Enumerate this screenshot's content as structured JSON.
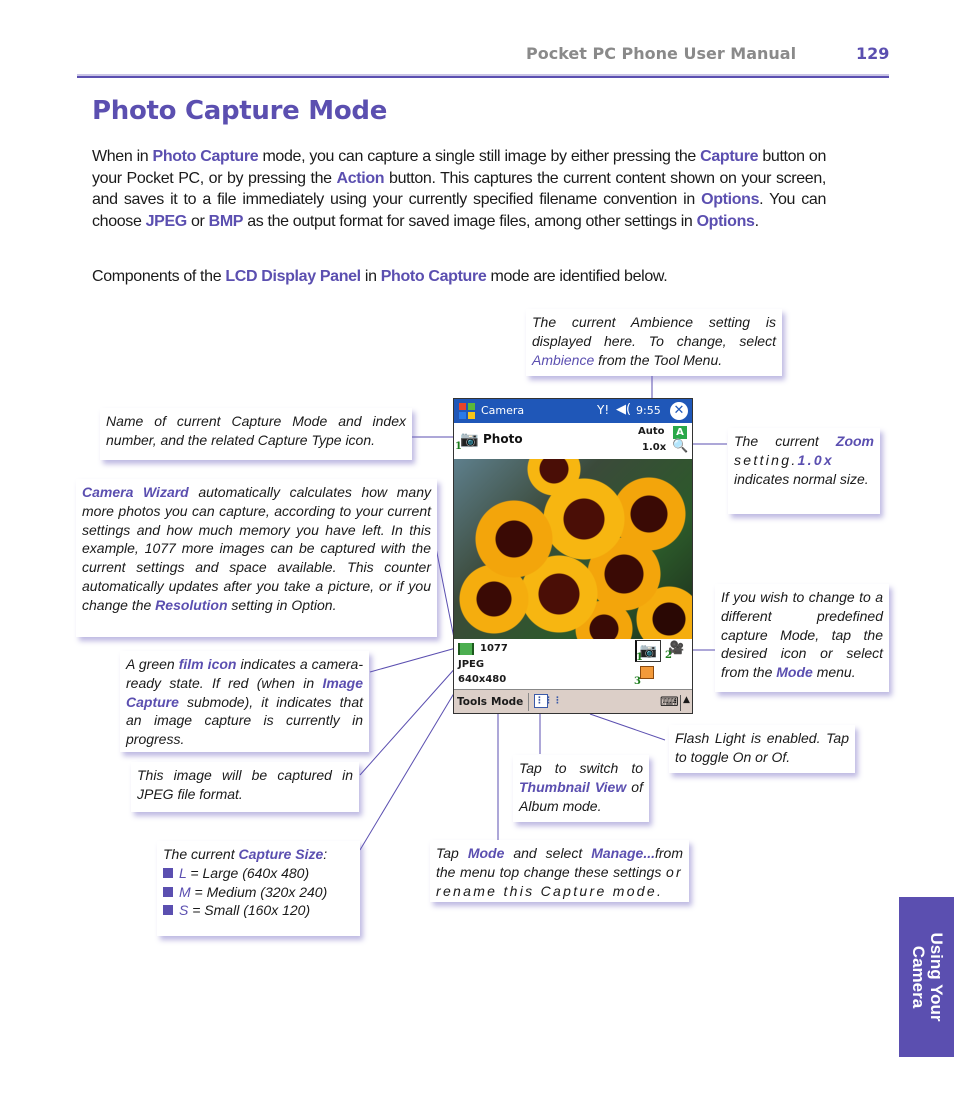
{
  "header": {
    "manual_title": "Pocket PC Phone User Manual",
    "page_number": "129"
  },
  "page_title": "Photo Capture Mode",
  "intro": {
    "p1": [
      {
        "t": "When in "
      },
      {
        "t": "Photo Capture",
        "hl": true
      },
      {
        "t": " mode, you can capture a single still image by either pressing the "
      },
      {
        "t": "Capture",
        "hl": true
      },
      {
        "t": " button on your Pocket PC, or by pressing the "
      },
      {
        "t": "Action",
        "hl": true
      },
      {
        "t": " button.  This captures the current content shown on your screen, and saves it to a file immediately using your currently specified filename convention in "
      },
      {
        "t": "Options",
        "hl": true
      },
      {
        "t": ".  You can choose "
      },
      {
        "t": "JPEG",
        "hl": true
      },
      {
        "t": " or "
      },
      {
        "t": "BMP",
        "hl": true
      },
      {
        "t": " as the output format for saved image files, among other settings in "
      },
      {
        "t": "Options",
        "hl": true
      },
      {
        "t": "."
      }
    ],
    "p2": [
      {
        "t": "Components of the "
      },
      {
        "t": "LCD Display Panel",
        "hl": true
      },
      {
        "t": " in "
      },
      {
        "t": "Photo Capture",
        "hl": true
      },
      {
        "t": " mode are identified below."
      }
    ]
  },
  "callouts": {
    "ambience": [
      {
        "t": "The current Ambience setting is displayed here. To change, select "
      },
      {
        "t": "Ambience",
        "plain_hl": true
      },
      {
        "t": " from the Tool Menu."
      }
    ],
    "mode_name": [
      {
        "t": "Name of current Capture Mode and index number, and the related Capture Type icon."
      }
    ],
    "zoom": [
      {
        "t": "The current "
      },
      {
        "t": "Zoom",
        "hl": true
      },
      {
        "t": " setting.",
        "wide": true
      },
      {
        "t": "1.0x",
        "hl": true,
        "wide": true
      },
      {
        "t": " indicates normal size."
      }
    ],
    "wizard": [
      {
        "t": "Camera  Wizard",
        "hl": true
      },
      {
        "t": " automatically calculates how many more photos you can capture, according to your current settings and how much memory you have left. In this example, 1077 more images can be captured with the current settings and space available. This counter automatically updates after you take a picture, or if you change the "
      },
      {
        "t": "Resolution",
        "hl": true
      },
      {
        "t": " setting in Option."
      }
    ],
    "change_mode": [
      {
        "t": "If you wish to change to a different predefined capture Mode, tap the desired icon or select from the "
      },
      {
        "t": "Mode",
        "hl": true
      },
      {
        "t": " menu."
      }
    ],
    "film_icon": [
      {
        "t": "A green "
      },
      {
        "t": "film icon",
        "hl": true
      },
      {
        "t": " indicates a camera-ready state.  If red (when in "
      },
      {
        "t": "Image Capture",
        "hl": true
      },
      {
        "t": " submode), it indicates that an image capture is currently in progress."
      }
    ],
    "flash": [
      {
        "t": "Flash Light is enabled. Tap to toggle On or Of."
      }
    ],
    "jpeg": [
      {
        "t": "This image will be captured in JPEG file format."
      }
    ],
    "thumbnail": [
      {
        "t": "Tap to switch to "
      },
      {
        "t": "Thumbnail View",
        "hl": true
      },
      {
        "t": " of Album mode."
      }
    ],
    "capture_size_title": [
      {
        "t": "The current "
      },
      {
        "t": "Capture Size",
        "hl": true
      },
      {
        "t": ":"
      }
    ],
    "capture_sizes": [
      {
        "key": "L",
        "desc": " = Large (640x 480)"
      },
      {
        "key": "M",
        "desc": " = Medium (320x 240)"
      },
      {
        "key": "S",
        "desc": " = Small (160x 120)"
      }
    ],
    "manage": [
      {
        "t": "Tap "
      },
      {
        "t": "Mode",
        "hl": true
      },
      {
        "t": " and select "
      },
      {
        "t": "Manage...",
        "hl": true
      },
      {
        "t": "from the menu top change these settings "
      },
      {
        "t": "or rename this Capture mode.",
        "wide": true
      }
    ]
  },
  "device": {
    "app_name": "Camera",
    "clock": "9:55",
    "signal_icon": "Y!",
    "volume_icon": "◀(",
    "close_icon": "✕",
    "mode_icon": "📷",
    "mode_index": "1",
    "mode_name": "Photo",
    "ambience": "Auto",
    "ambience_icon": "A",
    "zoom": "1.0x",
    "zoom_icon": "🔍",
    "shot_count": "1077",
    "format": "JPEG",
    "size": "640x480",
    "mode_buttons": [
      {
        "index": "1",
        "icon": "📷"
      },
      {
        "index": "2",
        "icon": "🎥"
      },
      {
        "index": "3",
        "icon": "👥"
      }
    ],
    "menu": {
      "tools": "Tools",
      "mode": "Mode",
      "thumbnail_icon": "⋮⋮⋮",
      "keyboard_icon": "⌨",
      "sip_arrow": "▲"
    },
    "photo_description": "sunflowers"
  },
  "side_tab": {
    "line1": "Using Your",
    "line2": "Camera"
  },
  "colors": {
    "accent": "#5b4fb0",
    "header_gray": "#8a8a8a",
    "titlebar_blue": "#1f57b8"
  }
}
